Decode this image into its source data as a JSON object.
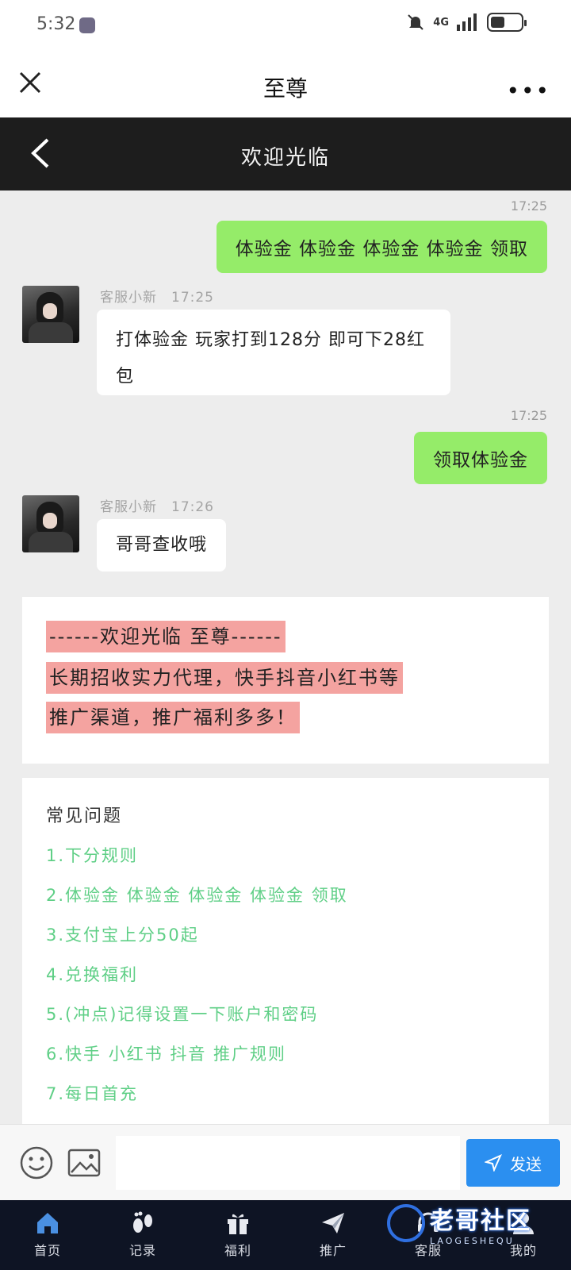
{
  "status_bar": {
    "time": "5:32",
    "network": "4G"
  },
  "webview": {
    "title": "至尊",
    "more_label": "•••"
  },
  "header": {
    "title": "欢迎光临"
  },
  "chat": {
    "messages": [
      {
        "time": "17:25",
        "text": "体验金 体验金 体验金 体验金 领取"
      },
      {
        "sender": "客服小新",
        "time": "17:25",
        "text": "打体验金 玩家打到128分  即可下28红包"
      },
      {
        "time": "17:25",
        "text": "领取体验金"
      },
      {
        "sender": "客服小新",
        "time": "17:26",
        "text": "哥哥查收哦"
      }
    ]
  },
  "notice": {
    "lines": [
      "------欢迎光临  至尊------",
      "长期招收实力代理，快手抖音小红书等",
      "推广渠道，推广福利多多！"
    ],
    "highlight_color": "#f4a3a0"
  },
  "faq": {
    "title": "常见问题",
    "items": [
      "1.下分规则",
      "2.体验金 体验金 体验金 体验金 领取",
      "3.支付宝上分50起",
      "4.兑换福利",
      "5.(冲点)记得设置一下账户和密码",
      "6.快手 小红书 抖音 推广规则",
      "7.每日首充"
    ],
    "item_color": "#5fcf86"
  },
  "input": {
    "placeholder": "",
    "send_label": "发送"
  },
  "nav": {
    "items": [
      {
        "label": "首页",
        "icon": "home-icon"
      },
      {
        "label": "记录",
        "icon": "footprint-icon"
      },
      {
        "label": "福利",
        "icon": "gift-icon"
      },
      {
        "label": "推广",
        "icon": "paper-plane-icon"
      },
      {
        "label": "客服",
        "icon": "headset-icon"
      },
      {
        "label": "我的",
        "icon": "user-icon"
      }
    ]
  },
  "watermark": {
    "main": "老哥社区",
    "sub": "LAOGESHEQU"
  },
  "colors": {
    "my_bubble": "#95ec69",
    "header_bg": "#1d1d1d",
    "send_button": "#2b8ff0",
    "nav_bg": "#0e1424"
  }
}
